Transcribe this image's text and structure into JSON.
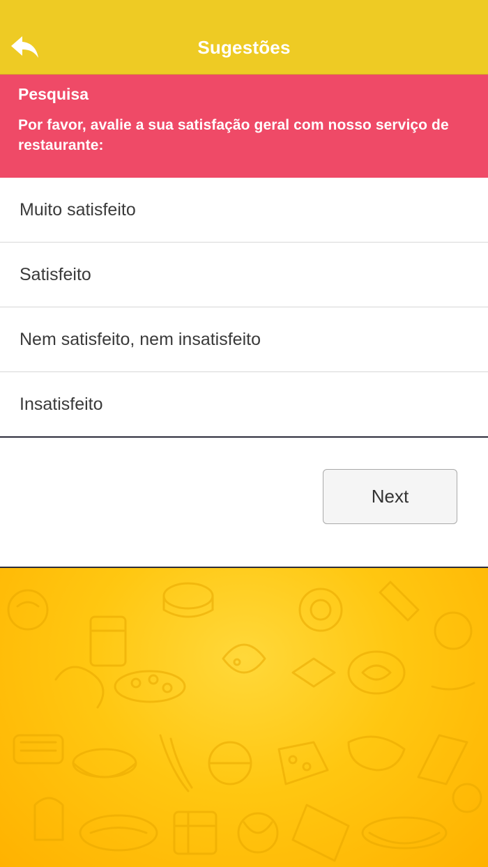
{
  "nav": {
    "title": "Sugestões",
    "back_icon": "reply-arrow-icon"
  },
  "survey": {
    "title": "Pesquisa",
    "question": "Por favor, avalie a sua satisfação geral com nosso serviço de restaurante:"
  },
  "options": [
    {
      "label": "Muito satisfeito"
    },
    {
      "label": "Satisfeito"
    },
    {
      "label": "Nem satisfeito, nem insatisfeito"
    },
    {
      "label": "Insatisfeito"
    }
  ],
  "actions": {
    "next_label": "Next"
  },
  "colors": {
    "nav_background": "#eecb24",
    "header_background": "#ef4a67",
    "pattern_background": "#ffc711"
  }
}
